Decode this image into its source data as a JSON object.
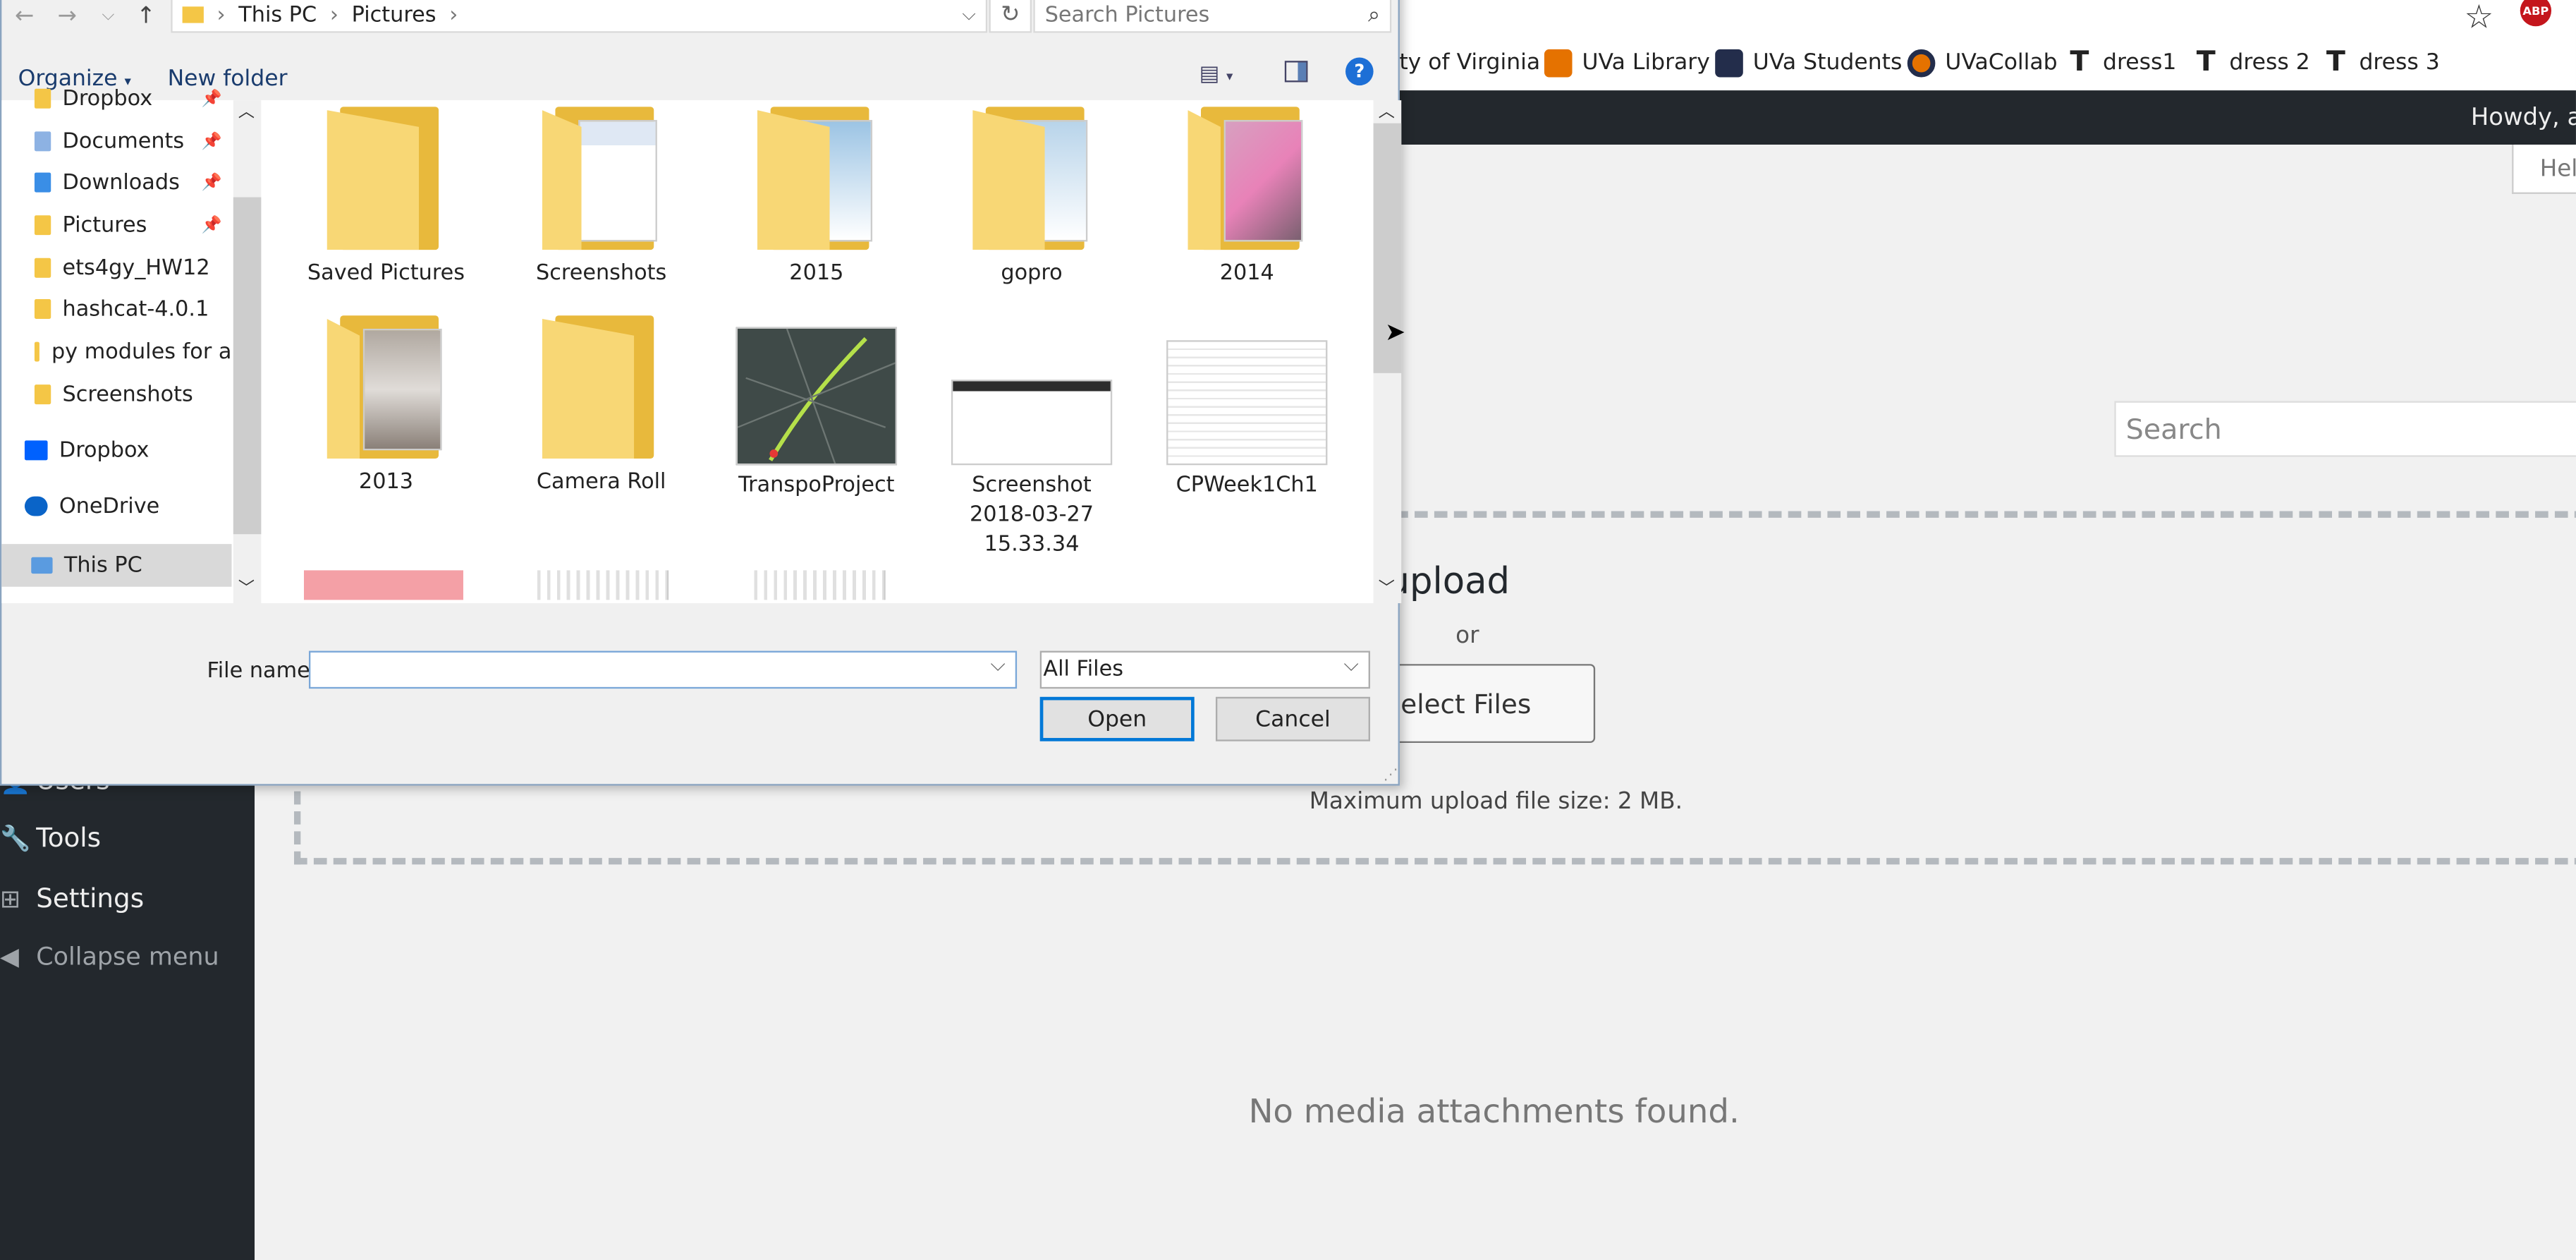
{
  "browser": {
    "bookmarks": [
      {
        "label": "ity of Virginia",
        "icon": "university-icon"
      },
      {
        "label": "UVa Library",
        "icon": "rotunda-icon"
      },
      {
        "label": "UVa Students",
        "icon": "rotunda-icon"
      },
      {
        "label": "UVaCollab",
        "icon": "uva-collab-icon"
      },
      {
        "label": "dress1",
        "icon": "text-t-icon"
      },
      {
        "label": "dress 2",
        "icon": "text-t-icon"
      },
      {
        "label": "dress 3",
        "icon": "text-t-icon"
      }
    ],
    "abp_label": "ABP"
  },
  "admin_bar": {
    "greeting": "Howdy, ac"
  },
  "admin_menu": [
    {
      "label": "Users",
      "icon": "users-icon"
    },
    {
      "label": "Tools",
      "icon": "wrench-icon"
    },
    {
      "label": "Settings",
      "icon": "settings-icon"
    },
    {
      "label": "Collapse menu",
      "icon": "collapse-icon"
    }
  ],
  "media": {
    "help_label": "Hel",
    "search_placeholder": "Search",
    "drop_text": "anywhere to upload",
    "or_text": "or",
    "select_files_label": "Select Files",
    "max_upload": "Maximum upload file size: 2 MB.",
    "empty_message": "No media attachments found."
  },
  "dialog": {
    "breadcrumb": [
      "This PC",
      "Pictures"
    ],
    "search_placeholder": "Search Pictures",
    "organize_label": "Organize",
    "new_folder_label": "New folder",
    "help_label": "?",
    "nav_items": [
      {
        "label": "Dropbox",
        "pinned": true
      },
      {
        "label": "Documents",
        "pinned": true
      },
      {
        "label": "Downloads",
        "pinned": true
      },
      {
        "label": "Pictures",
        "pinned": true
      },
      {
        "label": "ets4gy_HW12",
        "pinned": false
      },
      {
        "label": "hashcat-4.0.1",
        "pinned": false
      },
      {
        "label": "py modules for a",
        "pinned": false
      },
      {
        "label": "Screenshots",
        "pinned": false
      },
      {
        "label": "Dropbox",
        "pinned": false
      },
      {
        "label": "OneDrive",
        "pinned": false
      },
      {
        "label": "This PC",
        "pinned": false,
        "selected": true
      }
    ],
    "items": [
      {
        "label": "Saved Pictures",
        "kind": "folder"
      },
      {
        "label": "Screenshots",
        "kind": "folder"
      },
      {
        "label": "2015",
        "kind": "folder"
      },
      {
        "label": "gopro",
        "kind": "folder"
      },
      {
        "label": "2014",
        "kind": "folder"
      },
      {
        "label": "2013",
        "kind": "folder"
      },
      {
        "label": "Camera Roll",
        "kind": "folder"
      },
      {
        "label": "TranspoProject",
        "kind": "image"
      },
      {
        "label": "Screenshot 2018-03-27 15.33.34",
        "kind": "image"
      },
      {
        "label": "CPWeek1Ch1",
        "kind": "image"
      }
    ],
    "file_name_label": "File name:",
    "file_name_value": "",
    "file_type": "All Files",
    "open_label": "Open",
    "cancel_label": "Cancel"
  }
}
